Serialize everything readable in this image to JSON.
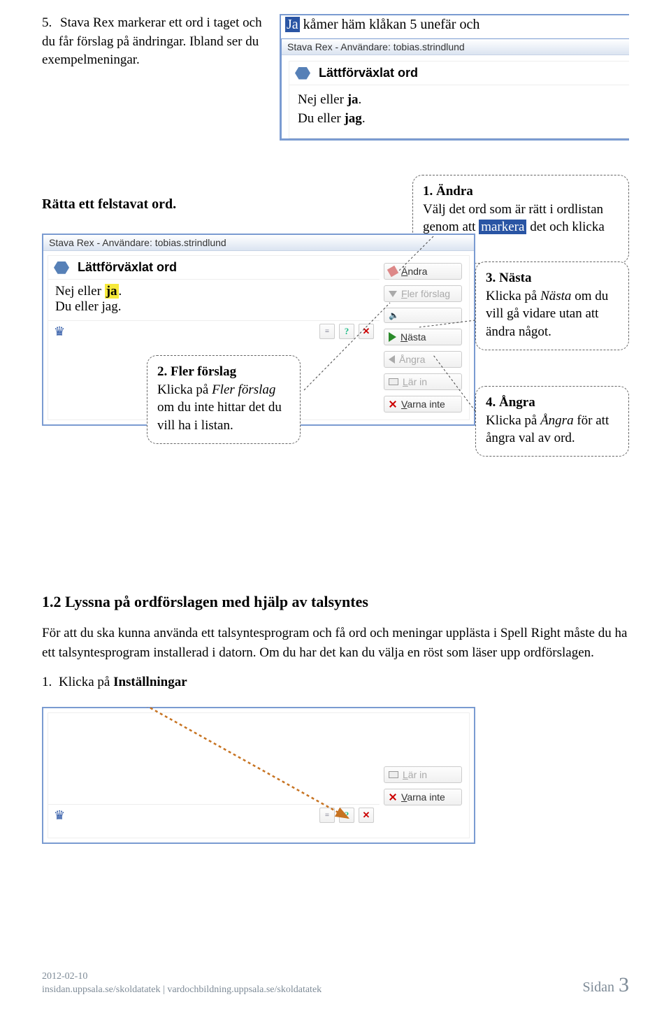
{
  "step5": {
    "num": "5.",
    "text_a": "Stava Rex markerar ett ord i taget och du får förslag på ändringar. Ibland ser du exempelmeningar."
  },
  "edit_strip": {
    "highlighted": "Ja",
    "rest": " kåmer häm klåkan 5 unefär och "
  },
  "window_small": {
    "title": "Stava Rex - Användare: tobias.strindlund",
    "head": "Lättförväxlat ord",
    "line1_a": "Nej eller ",
    "line1_b": "ja",
    "line1_c": ".",
    "line2_a": "Du eller ",
    "line2_b": "jag",
    "line2_c": "."
  },
  "section_head": "Rätta ett felstavat ord.",
  "window_main": {
    "title": "Stava Rex - Användare: tobias.strindlund",
    "head": "Lättförväxlat ord",
    "line1_a": "Nej eller ",
    "line1_hl": "ja",
    "line1_c": ".",
    "line2_a": "Du eller ",
    "line2_b": "jag",
    "line2_c": "."
  },
  "buttons": {
    "andra": "Ändra",
    "fler": "Fler förslag",
    "nasta": "Nästa",
    "angra": "Ångra",
    "larin": "Lär in",
    "varna": "Varna inte"
  },
  "callouts": {
    "c1_title": "1. Ändra",
    "c1_text_a": "Välj det ord som är rätt i ordlistan genom att ",
    "c1_mark": "markera",
    "c1_text_b": " det och klicka på",
    "c2_title": "2. Fler förslag",
    "c2_text_a": "Klicka på ",
    "c2_em": "Fler förslag",
    "c2_text_b": " om du inte hittar det du vill ha i listan.",
    "c3_title": "3. Nästa",
    "c3_text_a": "Klicka på ",
    "c3_em": "Nästa",
    "c3_text_b": " om du vill gå vidare utan att ändra något.",
    "c4_title": "4. Ångra",
    "c4_text_a": "Klicka på ",
    "c4_em": "Ångra",
    "c4_text_b": " för att ångra val av ord."
  },
  "sec12": {
    "head": "1.2 Lyssna på ordförslagen med hjälp av talsyntes",
    "para": "För att du ska kunna använda ett talsyntesprogram och få ord och meningar upplästa i Spell Right måste du ha ett talsyntesprogram installerad i datorn. Om du har det kan du välja en röst som läser upp ordförslagen.",
    "step_num": "1.",
    "step_a": "Klicka på ",
    "step_b": "Inställningar"
  },
  "footer": {
    "date": "2012-02-10",
    "urls": "insidan.uppsala.se/skoldatatek | vardochbildning.uppsala.se/skoldatatek",
    "page_label": "Sidan ",
    "page_num": "3"
  }
}
